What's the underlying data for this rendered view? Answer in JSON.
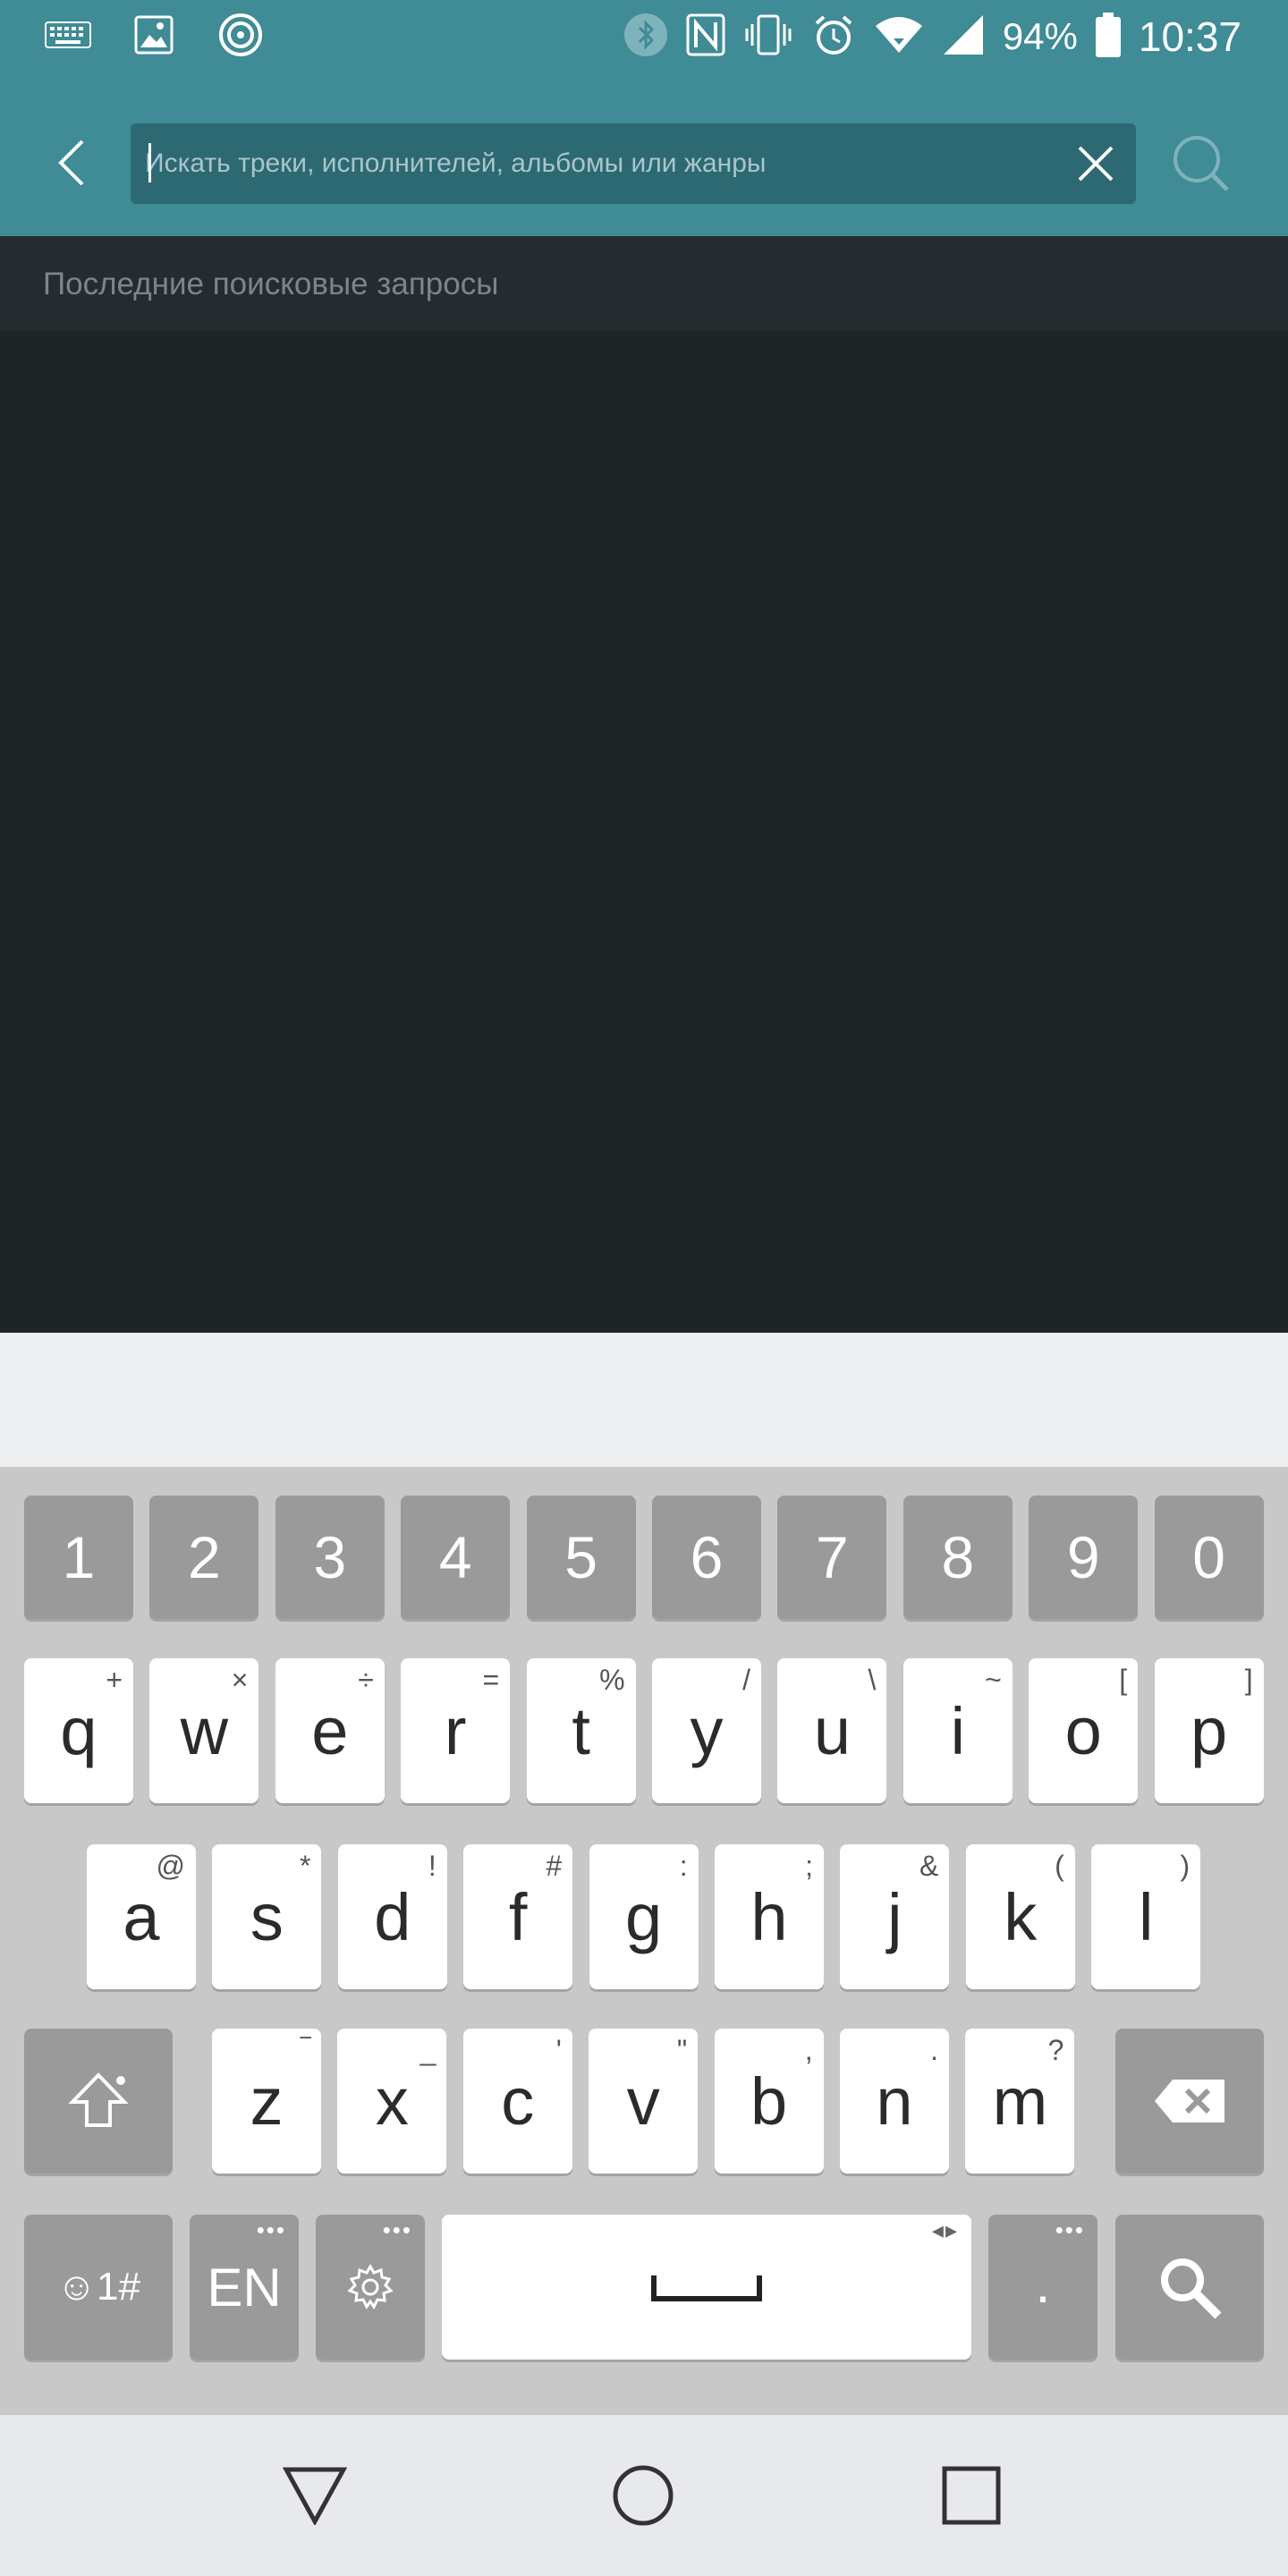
{
  "status_bar": {
    "battery_percent": "94%",
    "time": "10:37"
  },
  "app_bar": {
    "search_placeholder": "Искать треки, исполнителей, альбомы или жанры"
  },
  "recent_searches": {
    "header": "Последние поисковые запросы"
  },
  "keyboard": {
    "number_row": [
      "1",
      "2",
      "3",
      "4",
      "5",
      "6",
      "7",
      "8",
      "9",
      "0"
    ],
    "row1": [
      {
        "key": "q",
        "sec": "+"
      },
      {
        "key": "w",
        "sec": "×"
      },
      {
        "key": "e",
        "sec": "÷"
      },
      {
        "key": "r",
        "sec": "="
      },
      {
        "key": "t",
        "sec": "%"
      },
      {
        "key": "y",
        "sec": "/"
      },
      {
        "key": "u",
        "sec": "\\"
      },
      {
        "key": "i",
        "sec": "~"
      },
      {
        "key": "o",
        "sec": "["
      },
      {
        "key": "p",
        "sec": "]"
      }
    ],
    "row2": [
      {
        "key": "a",
        "sec": "@"
      },
      {
        "key": "s",
        "sec": "*"
      },
      {
        "key": "d",
        "sec": "!"
      },
      {
        "key": "f",
        "sec": "#"
      },
      {
        "key": "g",
        "sec": ":"
      },
      {
        "key": "h",
        "sec": ";"
      },
      {
        "key": "j",
        "sec": "&"
      },
      {
        "key": "k",
        "sec": "("
      },
      {
        "key": "l",
        "sec": ")"
      }
    ],
    "row3": [
      {
        "key": "z",
        "sec": "‾"
      },
      {
        "key": "x",
        "sec": "_"
      },
      {
        "key": "c",
        "sec": "'"
      },
      {
        "key": "v",
        "sec": "\""
      },
      {
        "key": "b",
        "sec": ","
      },
      {
        "key": "n",
        "sec": "."
      },
      {
        "key": "m",
        "sec": "?"
      }
    ],
    "symbols_label": "☺1#",
    "language_label": "EN",
    "period_label": ".",
    "more_dots": "•••"
  },
  "colors": {
    "app_bar": "#3f8b96",
    "search_field": "#2d6972",
    "background": "#1f2427",
    "keyboard": "#c8c8c8"
  }
}
